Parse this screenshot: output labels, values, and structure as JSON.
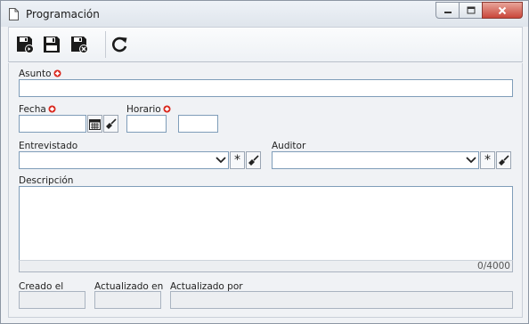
{
  "window": {
    "title": "Programación",
    "icons": {
      "document": "document-icon",
      "minimize": "minimize-icon",
      "maximize": "maximize-icon",
      "close": "close-icon"
    }
  },
  "toolbar": {
    "buttons": [
      {
        "name": "save-and-new-button",
        "icon": "save-new-icon"
      },
      {
        "name": "save-button",
        "icon": "save-icon"
      },
      {
        "name": "save-and-close-button",
        "icon": "save-close-icon"
      },
      {
        "name": "refresh-button",
        "icon": "refresh-icon"
      }
    ]
  },
  "form": {
    "asunto": {
      "label": "Asunto",
      "value": "",
      "required": true
    },
    "fecha": {
      "label": "Fecha",
      "value": "",
      "required": true
    },
    "horario": {
      "label": "Horario",
      "start": "",
      "end": "",
      "required": true
    },
    "entrevistado": {
      "label": "Entrevistado",
      "value": "",
      "clear_glyph": "*"
    },
    "auditor": {
      "label": "Auditor",
      "value": "",
      "clear_glyph": "*"
    },
    "descripcion": {
      "label": "Descripción",
      "value": "",
      "counter": "0/4000"
    },
    "creado_el": {
      "label": "Creado el",
      "value": ""
    },
    "actualizado_en": {
      "label": "Actualizado en",
      "value": ""
    },
    "actualizado_por": {
      "label": "Actualizado por",
      "value": ""
    }
  },
  "colors": {
    "required_marker": "#d9261c",
    "field_border": "#7f9db9",
    "close_button": "#c9463a"
  }
}
